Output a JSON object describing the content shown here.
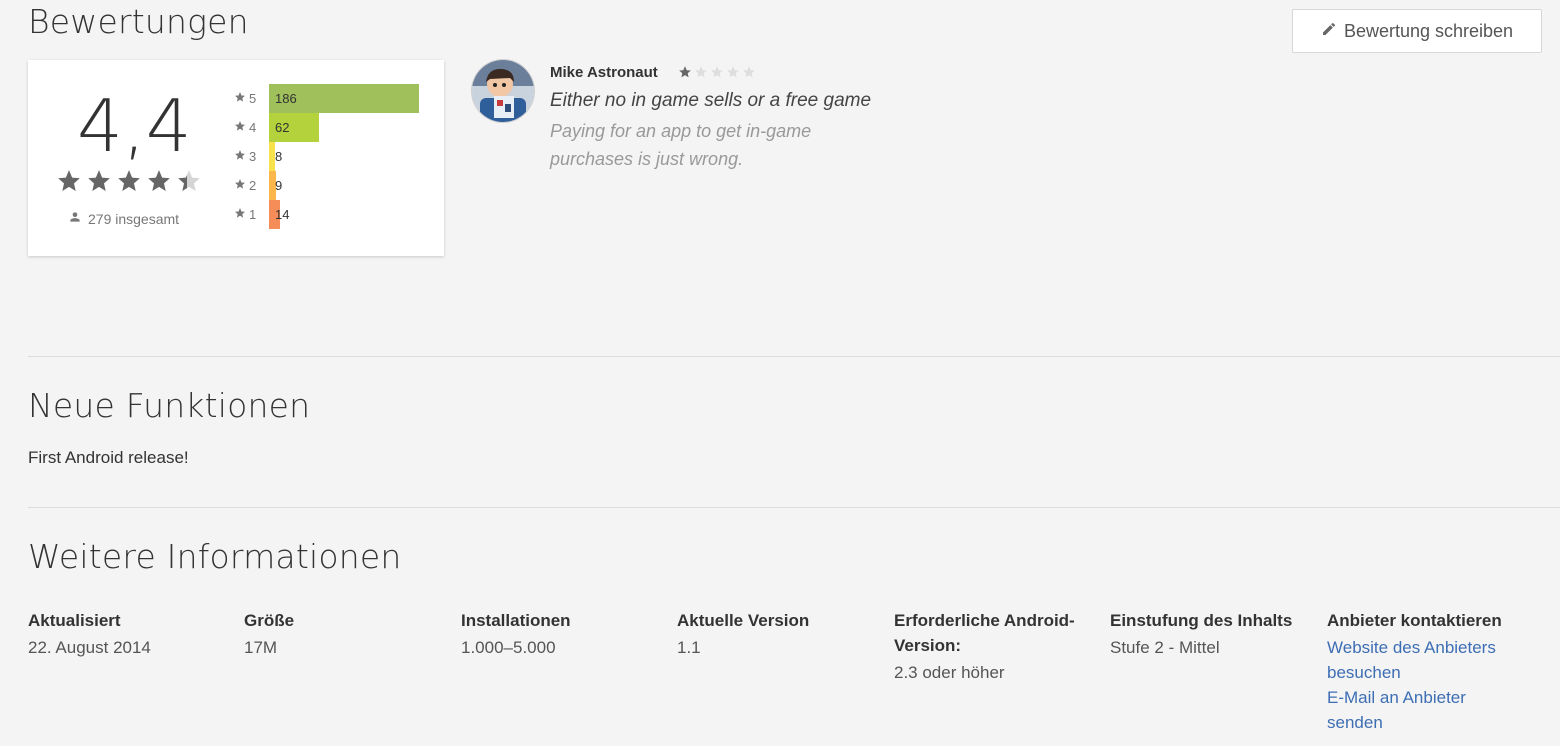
{
  "reviews": {
    "title": "Bewertungen",
    "write_button": "Bewertung schreiben",
    "score": "4,4",
    "average_stars": 4.4,
    "total": "279 insgesamt",
    "histogram": [
      {
        "star": "5",
        "count": "186",
        "value": 186,
        "color": "#9fc05a"
      },
      {
        "star": "4",
        "count": "62",
        "value": 62,
        "color": "#b3d23b"
      },
      {
        "star": "3",
        "count": "8",
        "value": 8,
        "color": "#f9e14c"
      },
      {
        "star": "2",
        "count": "9",
        "value": 9,
        "color": "#fcb74c"
      },
      {
        "star": "1",
        "count": "14",
        "value": 14,
        "color": "#f58d59"
      }
    ],
    "review": {
      "author": "Mike Astronaut",
      "stars": 1,
      "title": "Either no in game sells or a free game",
      "body": "Paying for an app to get in-game purchases is just wrong."
    }
  },
  "whats_new": {
    "title": "Neue Funktionen",
    "text": "First Android release!"
  },
  "additional_info": {
    "title": "Weitere Informationen",
    "columns": [
      {
        "label": "Aktualisiert",
        "value": "22. August 2014"
      },
      {
        "label": "Größe",
        "value": "17M"
      },
      {
        "label": "Installationen",
        "value": "1.000–5.000"
      },
      {
        "label": "Aktuelle Version",
        "value": "1.1"
      },
      {
        "label": "Erforderliche Android-Version:",
        "value": "2.3 oder höher"
      },
      {
        "label": "Einstufung des Inhalts",
        "value": "Stufe 2 - Mittel"
      }
    ],
    "contact": {
      "label": "Anbieter kontaktieren",
      "website": "Website des Anbieters besuchen",
      "email": "E-Mail an Anbieter senden"
    }
  },
  "colors": {
    "star_filled": "#666666",
    "star_small_filled": "#666666",
    "star_empty": "#d5d5d5",
    "link": "#3d6eb4"
  }
}
